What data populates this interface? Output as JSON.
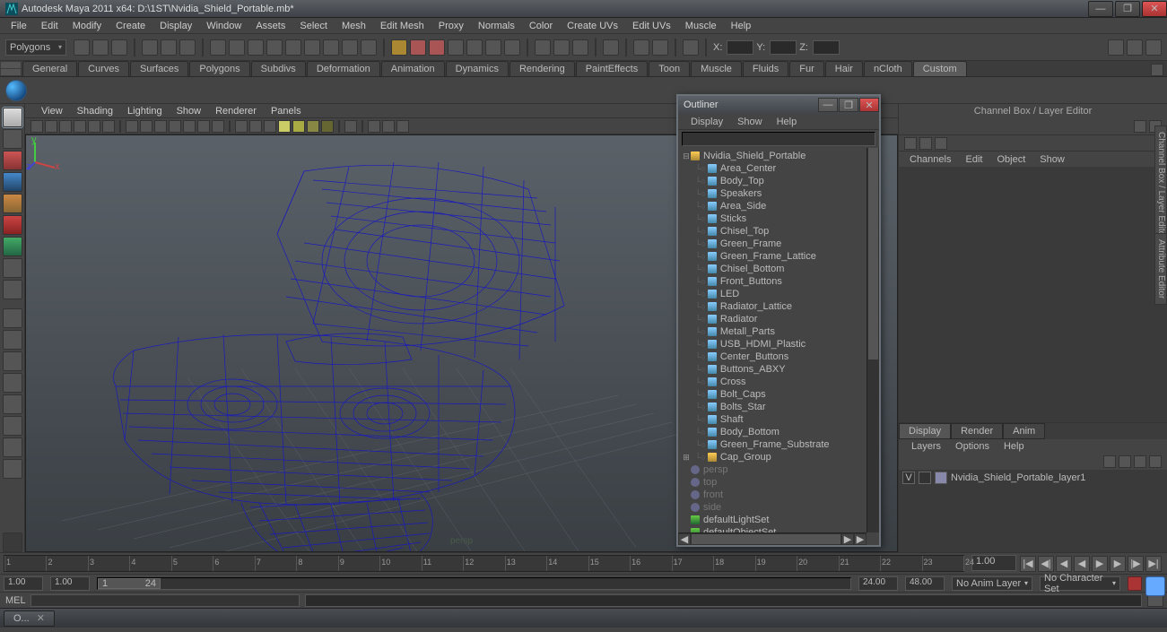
{
  "titlebar": {
    "title": "Autodesk Maya 2011 x64: D:\\1ST\\Nvidia_Shield_Portable.mb*"
  },
  "mainmenu": [
    "File",
    "Edit",
    "Modify",
    "Create",
    "Display",
    "Window",
    "Assets",
    "Select",
    "Mesh",
    "Edit Mesh",
    "Proxy",
    "Normals",
    "Color",
    "Create UVs",
    "Edit UVs",
    "Muscle",
    "Help"
  ],
  "shelftop": {
    "mode": "Polygons",
    "coords": {
      "x": "X:",
      "y": "Y:",
      "z": "Z:"
    }
  },
  "shelftabs": [
    "General",
    "Curves",
    "Surfaces",
    "Polygons",
    "Subdivs",
    "Deformation",
    "Animation",
    "Dynamics",
    "Rendering",
    "PaintEffects",
    "Toon",
    "Muscle",
    "Fluids",
    "Fur",
    "Hair",
    "nCloth",
    "Custom"
  ],
  "shelf_active": "Custom",
  "vp_menu": [
    "View",
    "Shading",
    "Lighting",
    "Show",
    "Renderer",
    "Panels"
  ],
  "outliner": {
    "title": "Outliner",
    "menu": [
      "Display",
      "Show",
      "Help"
    ],
    "root": "Nvidia_Shield_Portable",
    "children": [
      "Area_Center",
      "Body_Top",
      "Speakers",
      "Area_Side",
      "Sticks",
      "Chisel_Top",
      "Green_Frame",
      "Green_Frame_Lattice",
      "Chisel_Bottom",
      "Front_Buttons",
      "LED",
      "Radiator_Lattice",
      "Radiator",
      "Metall_Parts",
      "USB_HDMI_Plastic",
      "Center_Buttons",
      "Buttons_ABXY",
      "Cross",
      "Bolt_Caps",
      "Bolts_Star",
      "Shaft",
      "Body_Bottom",
      "Green_Frame_Substrate",
      "Cap_Group"
    ],
    "cameras": [
      "persp",
      "top",
      "front",
      "side"
    ],
    "sets": [
      "defaultLightSet",
      "defaultObjectSet"
    ]
  },
  "channelbox": {
    "title": "Channel Box / Layer Editor",
    "menu": [
      "Channels",
      "Edit",
      "Object",
      "Show"
    ],
    "vtab1": "Channel Box / Layer Editor",
    "vtab2": "Attribute Editor"
  },
  "layerbox": {
    "tabs": [
      "Display",
      "Render",
      "Anim"
    ],
    "active": "Display",
    "menu": [
      "Layers",
      "Options",
      "Help"
    ],
    "layer": {
      "vis": "V",
      "name": "Nvidia_Shield_Portable_layer1"
    }
  },
  "timeline": {
    "ticks": [
      "1",
      "2",
      "3",
      "4",
      "5",
      "6",
      "7",
      "8",
      "9",
      "10",
      "11",
      "12",
      "13",
      "14",
      "15",
      "16",
      "17",
      "18",
      "19",
      "20",
      "21",
      "22",
      "23",
      "24"
    ],
    "current": "1.00"
  },
  "range": {
    "start_outer": "1.00",
    "start_inner": "1.00",
    "end_inner": "24.00",
    "end_outer": "48.00",
    "thumb_start": "1",
    "thumb_end": "24",
    "anim_layer": "No Anim Layer",
    "char_set": "No Character Set"
  },
  "cmd": {
    "label": "MEL"
  },
  "taskbar": {
    "btn": "O..."
  }
}
